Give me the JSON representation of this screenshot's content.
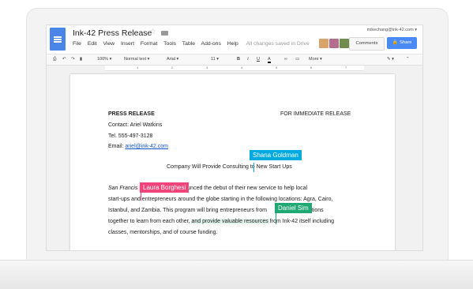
{
  "doc": {
    "title": "Ink-42 Press Release"
  },
  "menu": {
    "file": "File",
    "edit": "Edit",
    "view": "View",
    "insert": "Insert",
    "format": "Format",
    "tools": "Tools",
    "table": "Table",
    "addons": "Add-ons",
    "help": "Help",
    "save_status": "All changes saved in Drive"
  },
  "user": {
    "email": "mikechang@ink-42.com"
  },
  "buttons": {
    "comments": "Comments",
    "share": "Share"
  },
  "toolbar": {
    "zoom": "100%",
    "style": "Normal text",
    "font": "Arial",
    "size": "11",
    "more": "More"
  },
  "ruler": {
    "ticks": [
      "1",
      "2",
      "3",
      "4",
      "5",
      "6",
      "7"
    ]
  },
  "document": {
    "press_release": "PRESS RELEASE",
    "for_immediate": "FOR IMMEDIATE RELEASE",
    "contact": "Contact: Ariel Watkins",
    "tel": "Tel. 555-497-3128",
    "email_label": "Email: ",
    "email_link": "ariel@ink-42.com",
    "headline": "Company Will Provide Consulting to New Start Ups",
    "p1_l1_italic": "San Francis",
    "p1_l1_rest": " Ink-42 announced the debut of their new service to help local",
    "p1_l2": "start-ups and entrepreneurs around the globe starting in the following locations: Agra, Cairo,",
    "p1_l3": "Istanbul, and Zambia. This program will bring entrepreneurs from",
    "p1_l3_end": " locations",
    "p1_l4_a": "together to learn from each other, ",
    "p1_l4_green": "and provide valuable resources",
    "p1_l4_b": " from Ink-42 itself including",
    "p1_l5": "classes, mentorships, and of course funding."
  },
  "collaborators": [
    {
      "name": "Shana Goldman",
      "color": "#00a9e0"
    },
    {
      "name": "Laura Borghesi",
      "color": "#f0447a"
    },
    {
      "name": "Daniel Sim",
      "color": "#1fa774"
    }
  ],
  "colors": {
    "accent_blue": "#4a86e8",
    "share_blue": "#4a8af4"
  },
  "icons": [
    "docs-logo-icon",
    "star-icon",
    "folder-icon",
    "print-icon",
    "undo-icon",
    "redo-icon",
    "paint-format-icon",
    "bold-icon",
    "italic-icon",
    "underline-icon",
    "text-color-icon",
    "link-icon",
    "comment-icon",
    "pen-icon",
    "collapse-icon",
    "lock-icon"
  ]
}
